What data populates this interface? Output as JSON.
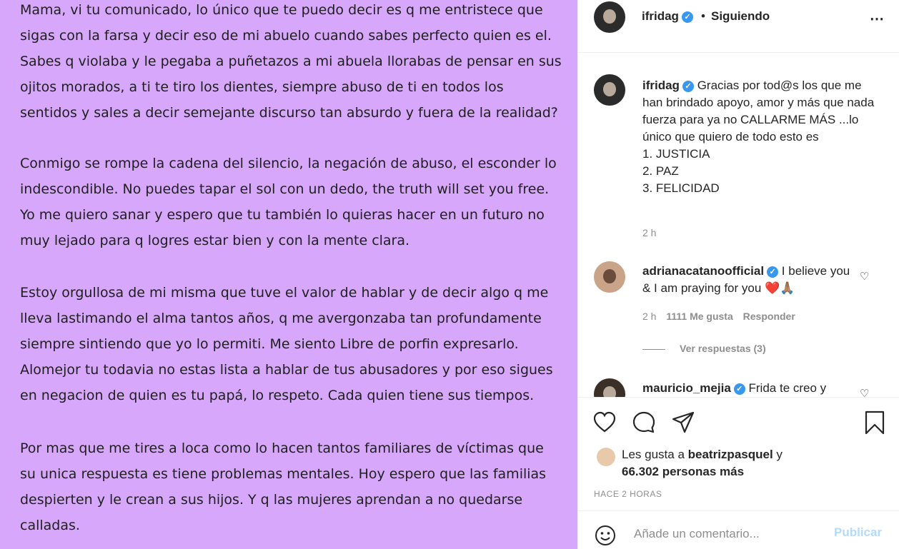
{
  "post": {
    "background": "#d7a7fb",
    "paragraphs": [
      [
        "Mama, vi tu comunicado, lo único que te puedo decir es q me entristece que",
        "sigas con la farsa y decir eso de mi abuelo cuando sabes perfecto quien es el.",
        "Sabes q violaba y le pegaba a puñetazos a mi abuela llorabas de pensar en sus",
        "ojitos morados, a ti te tiro los dientes, siempre abuso de ti en todos los",
        "sentidos y sales a decir semejante discurso tan absurdo y fuera de la realidad?"
      ],
      [
        "Conmigo se rompe la cadena del silencio, la negación de abuso, el esconder lo",
        "indescondible. No puedes tapar el sol con un dedo, the truth will set you free.",
        "Yo me quiero sanar y espero que tu también lo quieras hacer en un futuro no",
        "muy lejado para q logres estar bien y con la mente clara."
      ],
      [
        "Estoy orgullosa de mi misma que tuve el valor de hablar y de decir algo q me",
        "lleva lastimando el alma tantos años, q me avergonzaba tan profundamente",
        "siempre sintiendo que yo lo permiti. Me siento Libre de porfin expresarlo.",
        "Alomejor tu todavia no estas lista a hablar de tus abusadores y por eso sigues",
        "en negacion de quien es tu papá, lo respeto. Cada quien tiene sus tiempos."
      ],
      [
        "Por mas que me tires a loca como lo hacen tantos familiares de víctimas que",
        "su unica respuesta es tiene problemas mentales. Hoy espero que las familias",
        "despierten y le crean a sus hijos. Y q las mujeres aprendan a no quedarse",
        "calladas."
      ]
    ]
  },
  "header": {
    "username": "ifridag",
    "verified_mark": "✓",
    "dot": "•",
    "follow_status": "Siguiendo",
    "more_icon": "⋯"
  },
  "caption": {
    "username": "ifridag",
    "text": "Gracias por tod@s los que me han brindado apoyo, amor y más que nada fuerza para ya no CALLARME MÁS ...lo único que quiero de todo esto es",
    "list": [
      "1. JUSTICIA",
      "2. PAZ",
      "3. FELICIDAD"
    ],
    "time": "2 h"
  },
  "comments": [
    {
      "username": "adrianacatanoofficial",
      "text": "I believe you & I am praying for you ❤️🙏🏽",
      "time": "2 h",
      "likes": "1111 Me gusta",
      "reply": "Responder",
      "view_replies": "Ver respuestas (3)"
    },
    {
      "username": "mauricio_mejia",
      "text": "Frida te creo y"
    }
  ],
  "likes": {
    "prefix": "Les gusta a",
    "user": "beatrizpasquel",
    "middle": "y",
    "count": "66.302 personas más"
  },
  "time_ago": "HACE 2 HORAS",
  "comment_box": {
    "placeholder": "Añade un comentario...",
    "publish": "Publicar"
  },
  "icons": [
    "heart-icon",
    "comment-icon",
    "share-icon",
    "bookmark-icon",
    "emoji-icon",
    "verified-icon",
    "more-icon"
  ],
  "colors": {
    "verified": "#3897f0",
    "publish": "#b3dbff",
    "muted": "#8e8e8e",
    "text": "#262626"
  }
}
